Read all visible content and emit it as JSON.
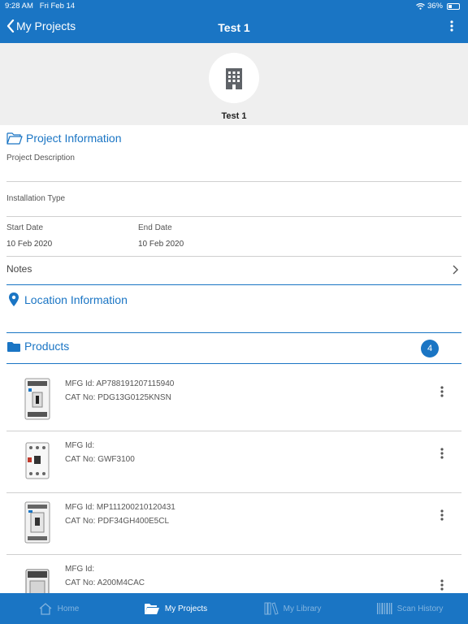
{
  "status": {
    "time": "9:28 AM",
    "date": "Fri Feb 14",
    "battery": "36%"
  },
  "nav": {
    "back_label": "My Projects",
    "title": "Test 1"
  },
  "project": {
    "name": "Test 1"
  },
  "project_info": {
    "heading": "Project Information",
    "description_label": "Project Description",
    "installation_label": "Installation Type",
    "start_label": "Start Date",
    "start_value": "10 Feb 2020",
    "end_label": "End Date",
    "end_value": "10 Feb 2020",
    "notes_label": "Notes"
  },
  "location": {
    "heading": "Location Information"
  },
  "products": {
    "heading": "Products",
    "count": "4",
    "items": [
      {
        "mfg": "MFG Id: AP788191207115940",
        "cat": "CAT No: PDG13G0125KNSN"
      },
      {
        "mfg": "MFG Id:",
        "cat": "CAT No: GWF3100"
      },
      {
        "mfg": "MFG Id: MP111200210120431",
        "cat": "CAT No: PDF34GH400E5CL"
      },
      {
        "mfg": "MFG Id:",
        "cat": "CAT No: A200M4CAC"
      }
    ]
  },
  "tabs": [
    {
      "label": "Home",
      "icon": "home-icon"
    },
    {
      "label": "My Projects",
      "icon": "folder-open-icon"
    },
    {
      "label": "My Library",
      "icon": "library-icon"
    },
    {
      "label": "Scan History",
      "icon": "barcode-icon"
    }
  ],
  "colors": {
    "accent": "#1a75c4",
    "header_bg": "#efefef"
  }
}
